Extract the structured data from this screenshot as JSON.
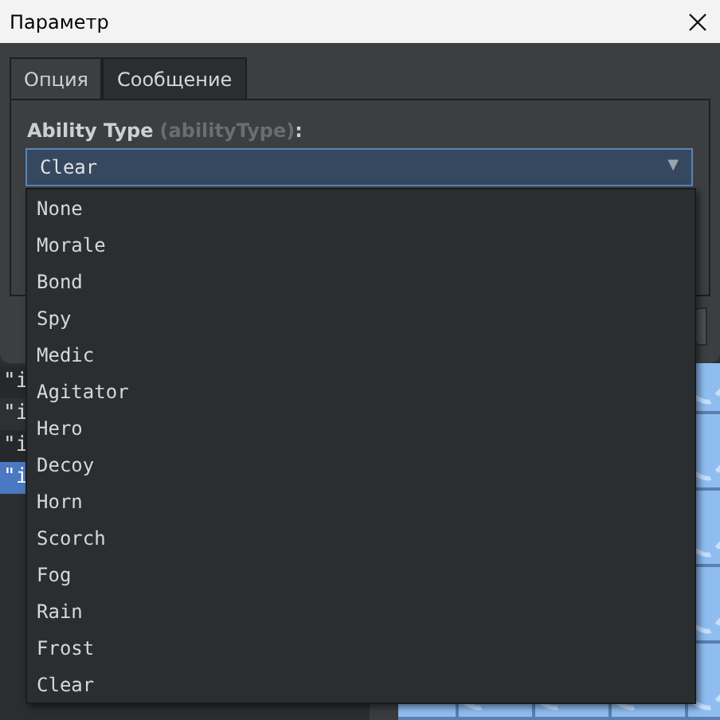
{
  "window": {
    "title": "Параметр"
  },
  "tabs": [
    {
      "label": "Опция",
      "selected": true
    },
    {
      "label": "Сообщение",
      "selected": false
    }
  ],
  "field": {
    "label": "Ability Type",
    "key": "(abilityType)",
    "suffix": ":",
    "value": "Clear",
    "arrow": "▼"
  },
  "options": [
    "None",
    "Morale",
    "Bond",
    "Spy",
    "Medic",
    "Agitator",
    "Hero",
    "Decoy",
    "Horn",
    "Scorch",
    "Fog",
    "Rain",
    "Frost",
    "Clear"
  ],
  "background_list": [
    {
      "text": "\"i",
      "selected": false
    },
    {
      "text": "\"i",
      "selected": false
    },
    {
      "text": "\"i",
      "selected": false
    },
    {
      "text": "\"i",
      "selected": true
    }
  ]
}
